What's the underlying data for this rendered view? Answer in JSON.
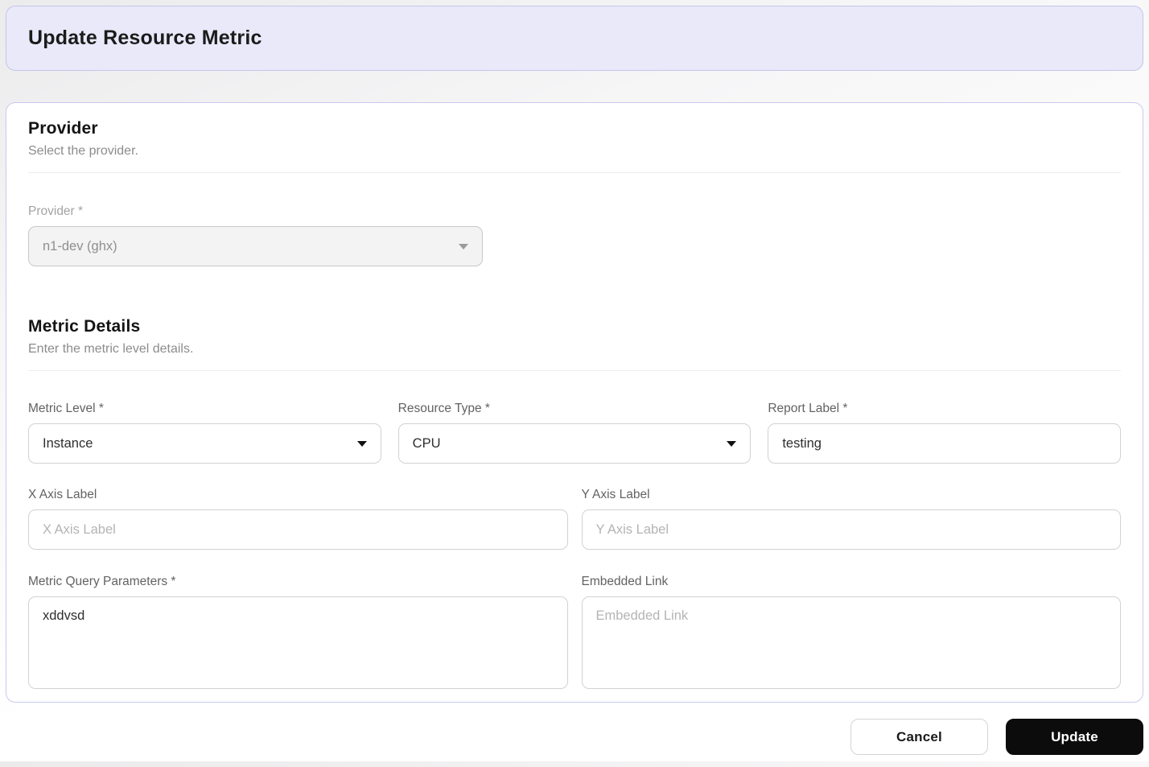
{
  "header": {
    "title": "Update Resource Metric"
  },
  "provider_section": {
    "heading": "Provider",
    "subtitle": "Select the provider.",
    "fields": {
      "provider": {
        "label": "Provider *",
        "value": "n1-dev (ghx)",
        "disabled": true
      }
    }
  },
  "metric_section": {
    "heading": "Metric Details",
    "subtitle": "Enter the metric level details.",
    "fields": {
      "metric_level": {
        "label": "Metric Level *",
        "value": "Instance"
      },
      "resource_type": {
        "label": "Resource Type *",
        "value": "CPU"
      },
      "report_label": {
        "label": "Report Label *",
        "value": "testing"
      },
      "x_axis_label": {
        "label": "X Axis Label",
        "placeholder": "X Axis Label",
        "value": ""
      },
      "y_axis_label": {
        "label": "Y Axis Label",
        "placeholder": "Y Axis Label",
        "value": ""
      },
      "metric_query_parameters": {
        "label": "Metric Query Parameters *",
        "value": "xddvsd"
      },
      "embedded_link": {
        "label": "Embedded Link",
        "placeholder": "Embedded Link",
        "value": ""
      }
    }
  },
  "footer": {
    "cancel_label": "Cancel",
    "update_label": "Update"
  },
  "colors": {
    "header_bg": "#e9e9fa",
    "header_border": "#c5c5ea",
    "card_border": "#c9c9ee",
    "primary_button_bg": "#0c0c0c",
    "disabled_field_bg": "#f3f3f3"
  }
}
